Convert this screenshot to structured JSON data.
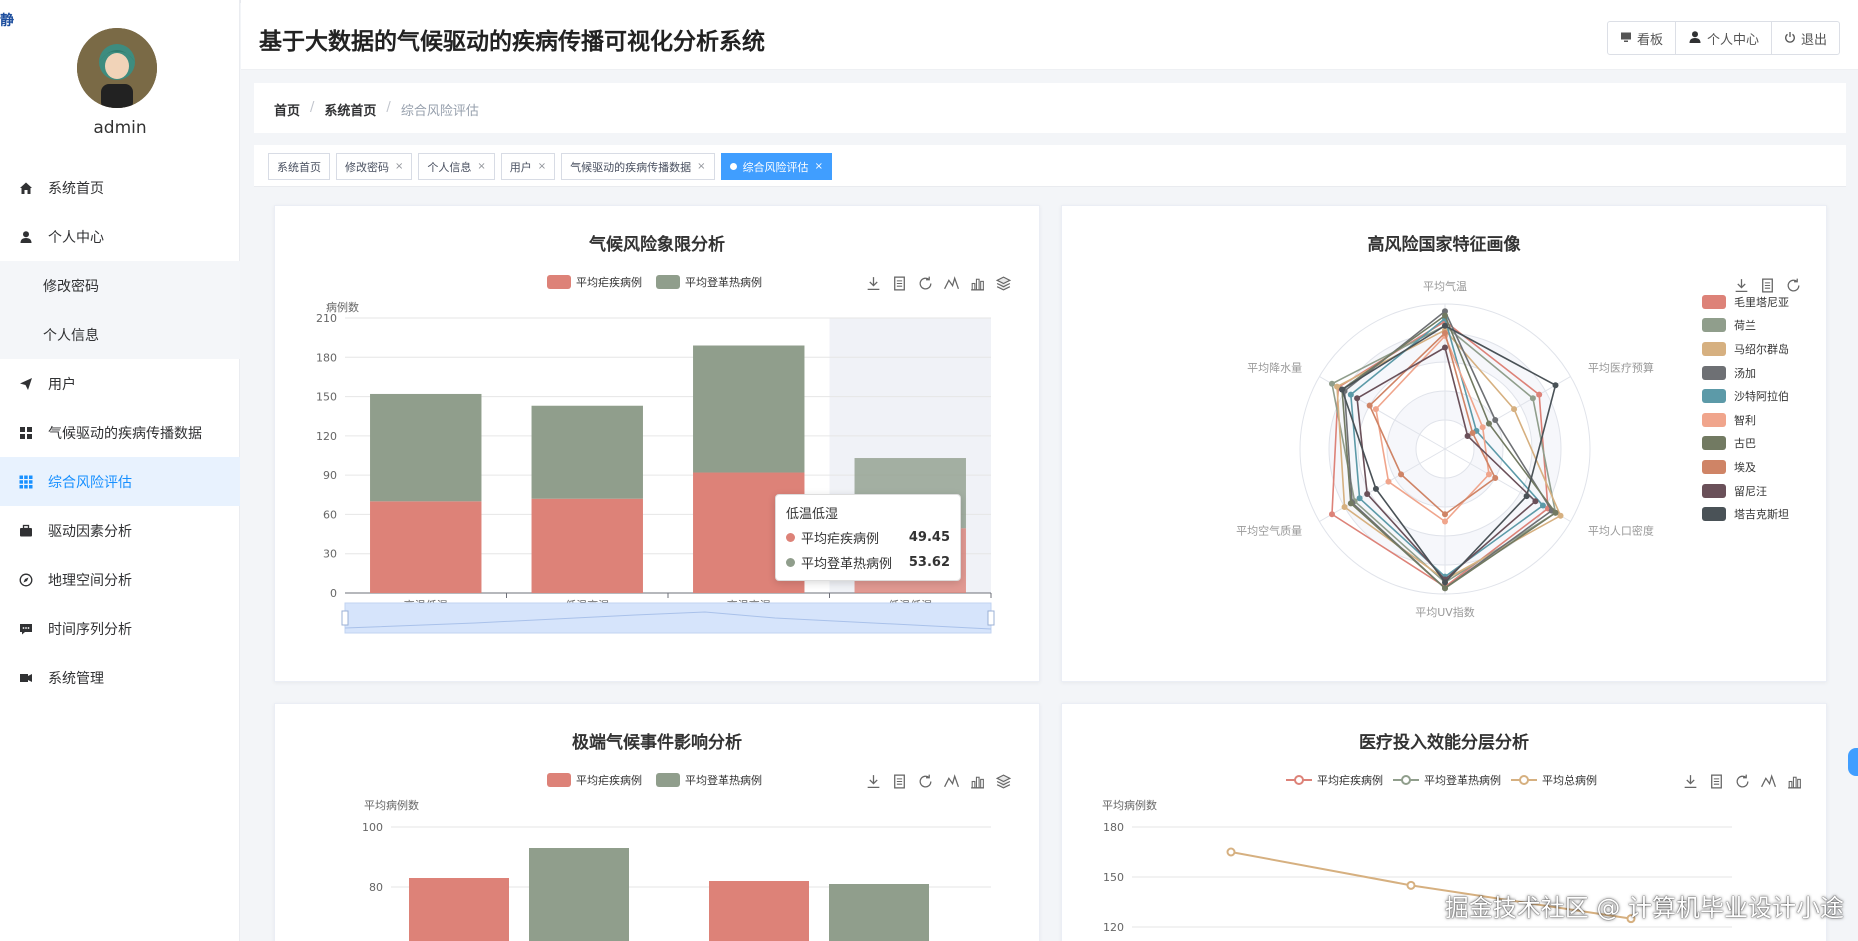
{
  "corner_text": "静",
  "user": {
    "name": "admin"
  },
  "menu": [
    {
      "label": "系统首页",
      "icon": "home-icon"
    },
    {
      "label": "个人中心",
      "icon": "user-icon"
    },
    {
      "label": "修改密码",
      "icon": "",
      "sub": true
    },
    {
      "label": "个人信息",
      "icon": "",
      "sub": true
    },
    {
      "label": "用户",
      "icon": "paper-plane-icon"
    },
    {
      "label": "气候驱动的疾病传播数据",
      "icon": "grid-icon"
    },
    {
      "label": "综合风险评估",
      "icon": "apps-icon",
      "active": true
    },
    {
      "label": "驱动因素分析",
      "icon": "briefcase-icon"
    },
    {
      "label": "地理空间分析",
      "icon": "compass-icon"
    },
    {
      "label": "时间序列分析",
      "icon": "chat-icon"
    },
    {
      "label": "系统管理",
      "icon": "tools-icon"
    }
  ],
  "header": {
    "title": "基于大数据的气候驱动的疾病传播可视化分析系统",
    "buttons": [
      {
        "label": "看板",
        "icon": "monitor-icon"
      },
      {
        "label": "个人中心",
        "icon": "user-icon"
      },
      {
        "label": "退出",
        "icon": "power-icon"
      }
    ]
  },
  "breadcrumb": {
    "home": "首页",
    "sep": "/",
    "section": "系统首页",
    "current": "综合风险评估"
  },
  "tags": [
    {
      "label": "系统首页",
      "closable": false
    },
    {
      "label": "修改密码",
      "closable": true
    },
    {
      "label": "个人信息",
      "closable": true
    },
    {
      "label": "用户",
      "closable": true
    },
    {
      "label": "气候驱动的疾病传播数据",
      "closable": true
    },
    {
      "label": "综合风险评估",
      "closable": true,
      "active": true
    }
  ],
  "colors": {
    "malaria": "#dd8278",
    "dengue": "#909e8c",
    "total": "#d6b080",
    "accent": "#409eff"
  },
  "card1": {
    "title": "气候风险象限分析",
    "legend": [
      "平均疟疾病例",
      "平均登革热病例"
    ],
    "ylabel": "病例数"
  },
  "tooltip1": {
    "title": "低温低湿",
    "rows": [
      {
        "name": "平均疟疾病例",
        "value": "49.45"
      },
      {
        "name": "平均登革热病例",
        "value": "53.62"
      }
    ]
  },
  "card2": {
    "title": "高风险国家特征画像"
  },
  "card3": {
    "title": "极端气候事件影响分析",
    "legend": [
      "平均疟疾病例",
      "平均登革热病例"
    ],
    "ylabel": "平均病例数"
  },
  "card4": {
    "title": "医疗投入效能分层分析",
    "legend": [
      "平均疟疾病例",
      "平均登革热病例",
      "平均总病例"
    ],
    "ylabel": "平均病例数"
  },
  "watermark": "掘金技术社区 @ 计算机毕业设计小途",
  "chart_data": [
    {
      "type": "bar",
      "title": "气候风险象限分析",
      "ylabel": "病例数",
      "categories": [
        "高温低湿",
        "低温高湿",
        "高温高湿",
        "低温低湿"
      ],
      "series": [
        {
          "name": "平均疟疾病例",
          "values": [
            70,
            72,
            92,
            49.45
          ]
        },
        {
          "name": "平均登革热病例",
          "values": [
            82,
            71,
            97,
            53.62
          ]
        }
      ],
      "stacked": true,
      "ylim": [
        0,
        210
      ],
      "yticks": [
        0,
        30,
        60,
        90,
        120,
        150,
        180,
        210
      ],
      "datazoom": true
    },
    {
      "type": "radar",
      "title": "高风险国家特征画像",
      "indicators": [
        "平均气温",
        "平均医疗预算",
        "平均人口密度",
        "平均UV指数",
        "平均空气质量",
        "平均降水量"
      ],
      "series": [
        {
          "name": "毛里塔尼亚",
          "values": [
            0.88,
            0.75,
            0.82,
            0.95,
            0.9,
            0.85
          ]
        },
        {
          "name": "荷兰",
          "values": [
            0.85,
            0.7,
            0.88,
            0.92,
            0.72,
            0.9
          ]
        },
        {
          "name": "马绍尔群岛",
          "values": [
            0.82,
            0.55,
            0.92,
            0.9,
            0.8,
            0.86
          ]
        },
        {
          "name": "汤加",
          "values": [
            0.95,
            0.4,
            0.85,
            0.96,
            0.74,
            0.8
          ]
        },
        {
          "name": "沙特阿拉伯",
          "values": [
            0.9,
            0.25,
            0.78,
            0.88,
            0.68,
            0.75
          ]
        },
        {
          "name": "智利",
          "values": [
            0.78,
            0.3,
            0.35,
            0.5,
            0.45,
            0.55
          ]
        },
        {
          "name": "古巴",
          "values": [
            0.92,
            0.35,
            0.88,
            0.96,
            0.75,
            0.82
          ]
        },
        {
          "name": "埃及",
          "values": [
            0.8,
            0.22,
            0.4,
            0.45,
            0.35,
            0.6
          ]
        },
        {
          "name": "留尼汪",
          "values": [
            0.7,
            0.18,
            0.72,
            0.9,
            0.62,
            0.7
          ]
        },
        {
          "name": "塔吉克斯坦",
          "values": [
            0.85,
            0.88,
            0.65,
            0.92,
            0.55,
            0.82
          ]
        }
      ]
    },
    {
      "type": "bar",
      "title": "极端气候事件影响分析",
      "ylabel": "平均病例数",
      "series": [
        {
          "name": "平均疟疾病例",
          "values": [
            83,
            82
          ]
        },
        {
          "name": "平均登革热病例",
          "values": [
            93,
            81
          ]
        }
      ],
      "yticks": [
        80,
        100
      ]
    },
    {
      "type": "line",
      "title": "医疗投入效能分层分析",
      "ylabel": "平均病例数",
      "series": [
        {
          "name": "平均总病例",
          "values": [
            165,
            145,
            125
          ]
        }
      ],
      "yticks": [
        120,
        150,
        180
      ]
    }
  ]
}
